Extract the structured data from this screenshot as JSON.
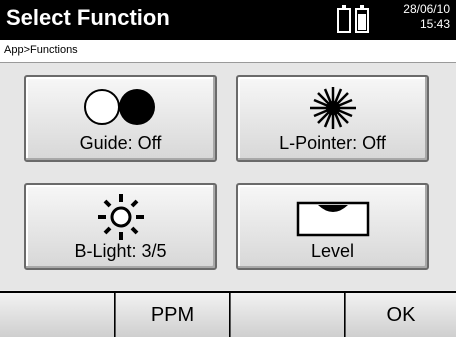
{
  "header": {
    "title": "Select Function",
    "date": "28/06/10",
    "time": "15:43",
    "icons": [
      "battery-empty-icon",
      "battery-full-icon"
    ]
  },
  "breadcrumb": "App>Functions",
  "functions": {
    "guide": {
      "label": "Guide: Off",
      "icon": "guide-circles-icon"
    },
    "lpointer": {
      "label": "L-Pointer: Off",
      "icon": "laser-pointer-icon"
    },
    "blight": {
      "label": "B-Light: 3/5",
      "icon": "backlight-sun-icon"
    },
    "level": {
      "label": "Level",
      "icon": "level-bubble-icon"
    }
  },
  "softkeys": {
    "key1": "",
    "key2": "PPM",
    "key3": "",
    "key4": "OK"
  }
}
